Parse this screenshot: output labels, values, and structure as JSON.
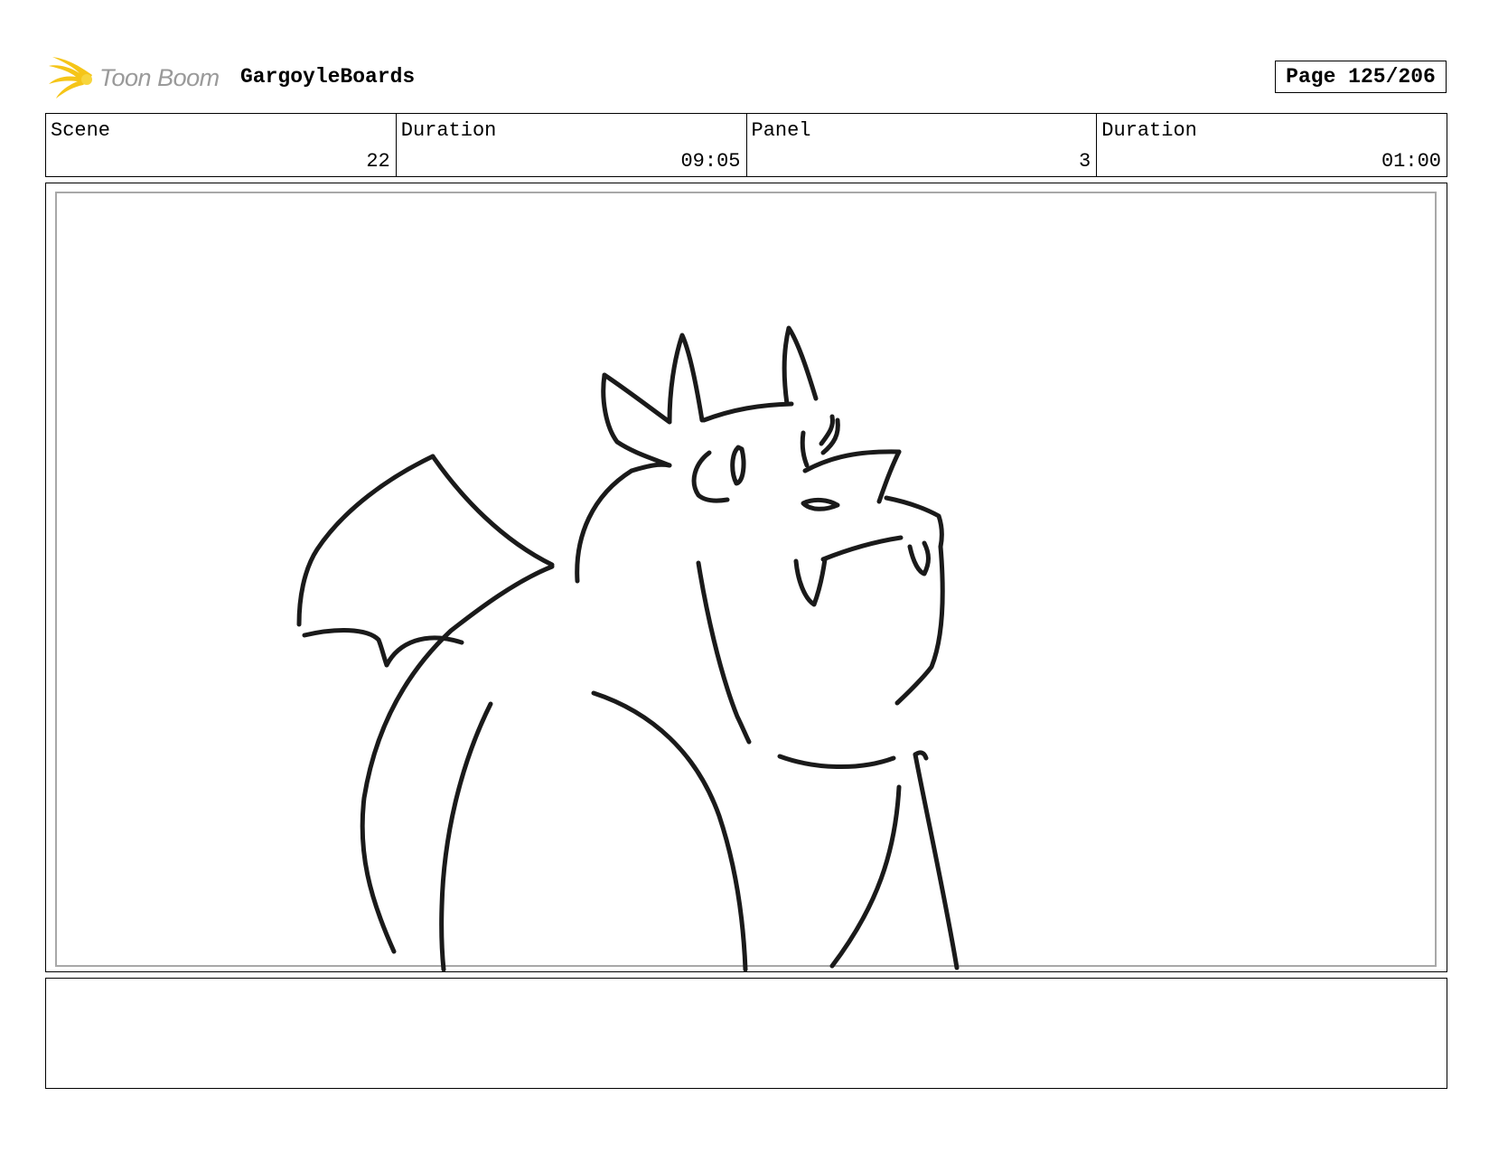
{
  "header": {
    "logo_text": "Toon Boom",
    "project_name": "GargoyleBoards",
    "page_label": "Page 125/206"
  },
  "info": {
    "scene_label": "Scene",
    "scene_value": "22",
    "scene_duration_label": "Duration",
    "scene_duration_value": "09:05",
    "panel_label": "Panel",
    "panel_value": "3",
    "panel_duration_label": "Duration",
    "panel_duration_value": "01:00"
  },
  "notes": {
    "text": ""
  },
  "colors": {
    "logo_star": "#f5c518",
    "logo_text": "#9a9a9a",
    "safe_area_border": "#a8a8a8",
    "sketch_stroke": "#1a1a1a"
  }
}
